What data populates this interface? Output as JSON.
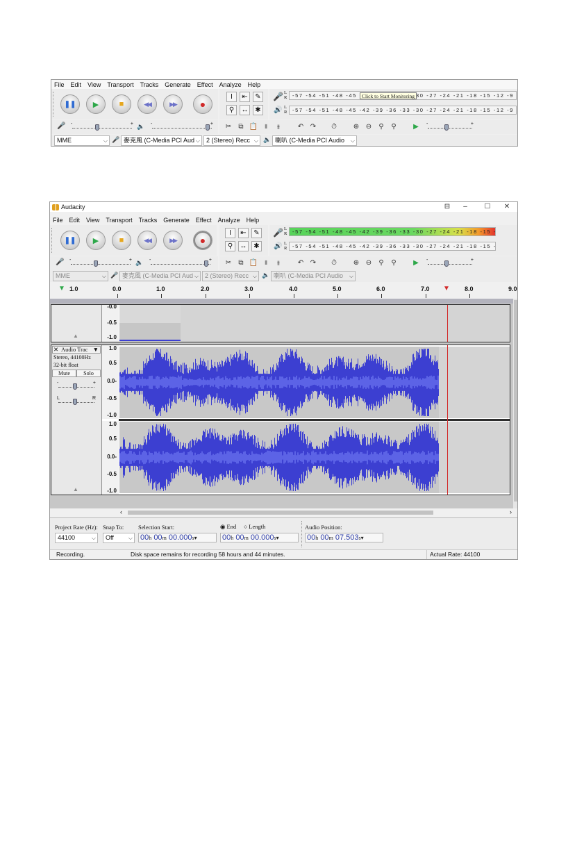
{
  "menu": [
    "File",
    "Edit",
    "View",
    "Transport",
    "Tracks",
    "Generate",
    "Effect",
    "Analyze",
    "Help"
  ],
  "window": {
    "title": "Audacity",
    "controls": {
      "restore": "⊟",
      "minimize": "–",
      "maximize": "☐",
      "close": "✕"
    }
  },
  "transport": {
    "pause_glyph": "❚❚",
    "play_glyph": "▶",
    "stop_glyph": "■",
    "skip_start_glyph": "◀◀",
    "skip_end_glyph": "▶▶",
    "record_glyph": "●"
  },
  "tools": {
    "select": "I",
    "envelope": "⇤",
    "draw": "✎",
    "zoom": "⚲",
    "timeshift": "↔",
    "multi": "✱"
  },
  "meters": {
    "L": "L",
    "R": "R",
    "scale": "-57 -54 -51 -48 -45 -42 -39 -36 -33 -30 -27 -24 -21 -18 -15 -12 -9 -6 -3 0",
    "monitor_tip": "Click to Start Monitoring",
    "recording_level": 0.97,
    "playback_level": 0.0
  },
  "mixer": {
    "rec_icon": "mic-icon",
    "play_icon": "speaker-icon",
    "minus": "-",
    "plus": "+",
    "rec_volume": 0.42,
    "play_volume": 0.98
  },
  "device": {
    "host": "MME",
    "input": "麥克風 (C-Media PCI Aud",
    "channels": "2 (Stereo) Recc",
    "output": "喇叭 (C-Media PCI Audio"
  },
  "timeline": {
    "labels": [
      "1.0",
      "0.0",
      "1.0",
      "2.0",
      "3.0",
      "4.0",
      "5.0",
      "6.0",
      "7.0",
      "8.0",
      "9.0"
    ],
    "playhead_seconds": 7.5
  },
  "track": {
    "name": "Audio Trac",
    "info1": "Stereo, 44100Hz",
    "info2": "32-bit float",
    "mute": "Mute",
    "solo": "Solo",
    "gain_minus": "-",
    "gain_plus": "+",
    "pan_left": "L",
    "pan_right": "R",
    "collapse_glyph": "▲",
    "close_glyph": "✕",
    "menu_glyph": "▼"
  },
  "prev_track": {
    "collapse_glyph": "▲",
    "vruler": [
      "-0.0",
      "-0.5",
      "-1.0"
    ]
  },
  "vruler_labels": [
    "1.0",
    "0.5",
    "0.0-",
    "-0.5",
    "-1.0"
  ],
  "bottom": {
    "project_rate_label": "Project Rate (Hz):",
    "project_rate": "44100",
    "snap_label": "Snap To:",
    "snap_value": "Off",
    "selection_start_label": "Selection Start:",
    "end_label": "End",
    "length_label": "Length",
    "audio_position_label": "Audio Position:",
    "sel_start": {
      "h": "00",
      "m": "00",
      "s": "00.000"
    },
    "sel_end": {
      "h": "00",
      "m": "00",
      "s": "00.000"
    },
    "audio_pos": {
      "h": "00",
      "m": "00",
      "s": "07.503"
    },
    "unit_h": "h",
    "unit_m": "m",
    "unit_s": "s"
  },
  "status": {
    "state": "Recording.",
    "disk": "Disk space remains for recording 58 hours and 44 minutes.",
    "rate": "Actual Rate: 44100"
  },
  "colors": {
    "waveform": "#3c3fd1",
    "playhead": "#d22a2a",
    "time_digits": "#2f3fa8",
    "meter_green": "#57d35a"
  }
}
